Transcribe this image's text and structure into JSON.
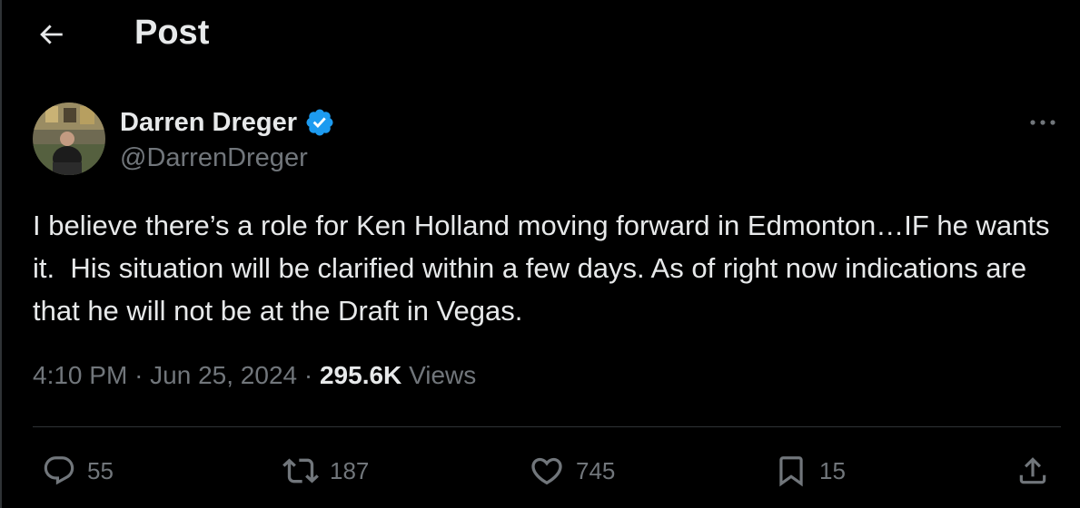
{
  "header": {
    "title": "Post",
    "back_icon": "arrow-left-icon"
  },
  "post": {
    "author": {
      "display_name": "Darren Dreger",
      "handle": "@DarrenDreger",
      "verified": true,
      "verified_color": "#1d9bf0"
    },
    "text": "I believe there’s a role for Ken Holland moving forward in Edmonton…IF he wants it.  His situation will be clarified within a few days. As of right now indications are that he will not be at the Draft in Vegas.",
    "time": "4:10 PM",
    "separator": "·",
    "date": "Jun 25, 2024",
    "views_count": "295.6K",
    "views_label": "Views"
  },
  "actions": {
    "replies": "55",
    "reposts": "187",
    "likes": "745",
    "bookmarks": "15"
  },
  "colors": {
    "background": "#000000",
    "text": "#e7e9ea",
    "muted": "#71767b",
    "divider": "#2f3336"
  }
}
